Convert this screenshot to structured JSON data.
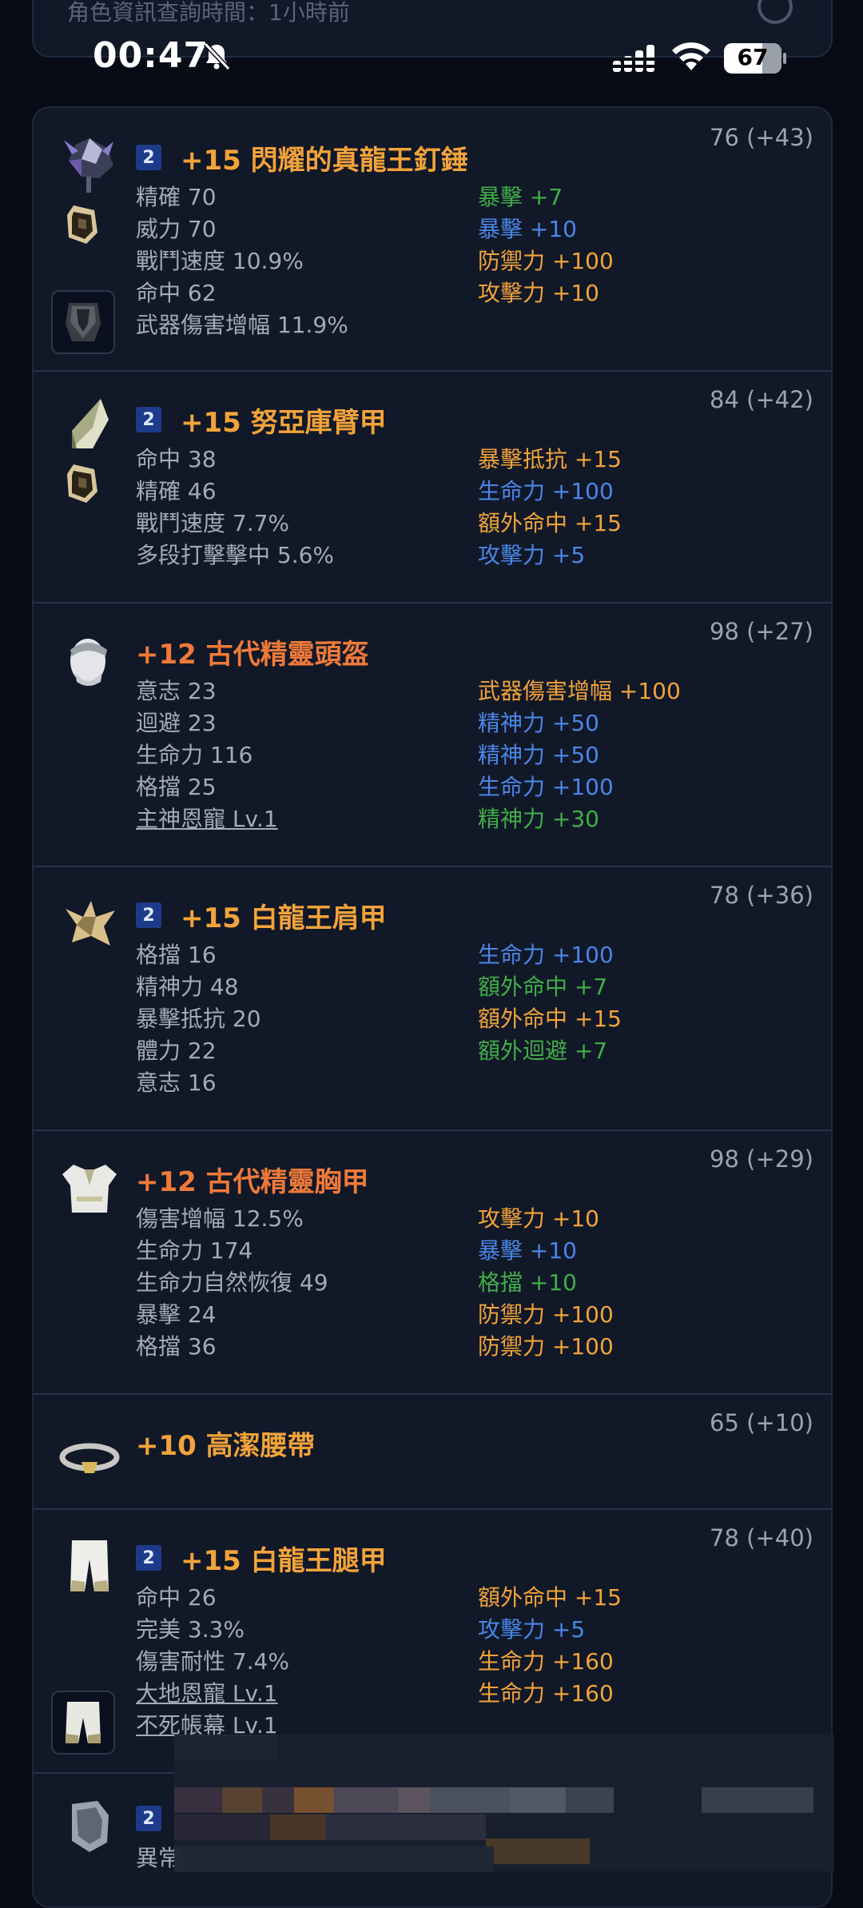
{
  "top_search": {
    "text": "角色資訊查詢時間：1小時前"
  },
  "status_bar": {
    "time": "00:47",
    "battery": "67"
  },
  "items": [
    {
      "tier_badge": "2",
      "title": "+15 閃耀的真龍王釘錘",
      "score": "76 (+43)",
      "stats": [
        "精確 70",
        "威力 70",
        "戰鬥速度 10.9%",
        "命中 62",
        "武器傷害增幅 11.9%"
      ],
      "bonuses": [
        {
          "text": "暴擊 +7",
          "color": "green"
        },
        {
          "text": "暴擊 +10",
          "color": "blue"
        },
        {
          "text": "防禦力 +100",
          "color": "orange"
        },
        {
          "text": "攻擊力 +10",
          "color": "orange"
        }
      ]
    },
    {
      "tier_badge": "2",
      "title": "+15 努亞庫臂甲",
      "score": "84 (+42)",
      "stats": [
        "命中 38",
        "精確 46",
        "戰鬥速度 7.7%",
        "多段打擊擊中 5.6%"
      ],
      "bonuses": [
        {
          "text": "暴擊抵抗 +15",
          "color": "orange"
        },
        {
          "text": "生命力 +100",
          "color": "blue"
        },
        {
          "text": "額外命中 +15",
          "color": "orange"
        },
        {
          "text": "攻擊力 +5",
          "color": "blue"
        }
      ]
    },
    {
      "title": "+12 古代精靈頭盔",
      "score": "98 (+27)",
      "stats": [
        "意志 23",
        "迴避 23",
        "生命力 116",
        "格擋 25",
        "主神恩寵 Lv.1"
      ],
      "bonuses": [
        {
          "text": "武器傷害增幅 +100",
          "color": "orange"
        },
        {
          "text": "精神力 +50",
          "color": "blue"
        },
        {
          "text": "精神力 +50",
          "color": "blue"
        },
        {
          "text": "生命力 +100",
          "color": "blue"
        },
        {
          "text": "精神力 +30",
          "color": "green"
        }
      ]
    },
    {
      "tier_badge": "2",
      "title": "+15 白龍王肩甲",
      "score": "78 (+36)",
      "stats": [
        "格擋 16",
        "精神力 48",
        "暴擊抵抗 20",
        "體力 22",
        "意志 16"
      ],
      "bonuses": [
        {
          "text": "生命力 +100",
          "color": "blue"
        },
        {
          "text": "額外命中 +7",
          "color": "green"
        },
        {
          "text": "額外命中 +15",
          "color": "orange"
        },
        {
          "text": "額外迴避 +7",
          "color": "green"
        }
      ]
    },
    {
      "title": "+12 古代精靈胸甲",
      "score": "98 (+29)",
      "stats": [
        "傷害增幅 12.5%",
        "生命力 174",
        "生命力自然恢復 49",
        "暴擊 24",
        "格擋 36"
      ],
      "bonuses": [
        {
          "text": "攻擊力 +10",
          "color": "orange"
        },
        {
          "text": "暴擊 +10",
          "color": "blue"
        },
        {
          "text": "格擋 +10",
          "color": "green"
        },
        {
          "text": "防禦力 +100",
          "color": "orange"
        },
        {
          "text": "防禦力 +100",
          "color": "orange"
        }
      ]
    },
    {
      "title": "+10 高潔腰帶",
      "score": "65 (+10)",
      "stats": [],
      "bonuses": []
    },
    {
      "tier_badge": "2",
      "title": "+15 白龍王腿甲",
      "score": "78 (+40)",
      "stats": [
        "命中 26",
        "完美 3.3%",
        "傷害耐性 7.4%",
        "大地恩寵 Lv.1",
        "不死帳幕 Lv.1"
      ],
      "bonuses": [
        {
          "text": "額外命中 +15",
          "color": "orange"
        },
        {
          "text": "攻擊力 +5",
          "color": "blue"
        },
        {
          "text": "生命力 +160",
          "color": "orange"
        },
        {
          "text": "生命力 +160",
          "color": "orange"
        }
      ]
    },
    {
      "tier_badge": "2",
      "title": "",
      "score": "",
      "stats": [
        "異常"
      ],
      "bonuses": []
    }
  ]
}
